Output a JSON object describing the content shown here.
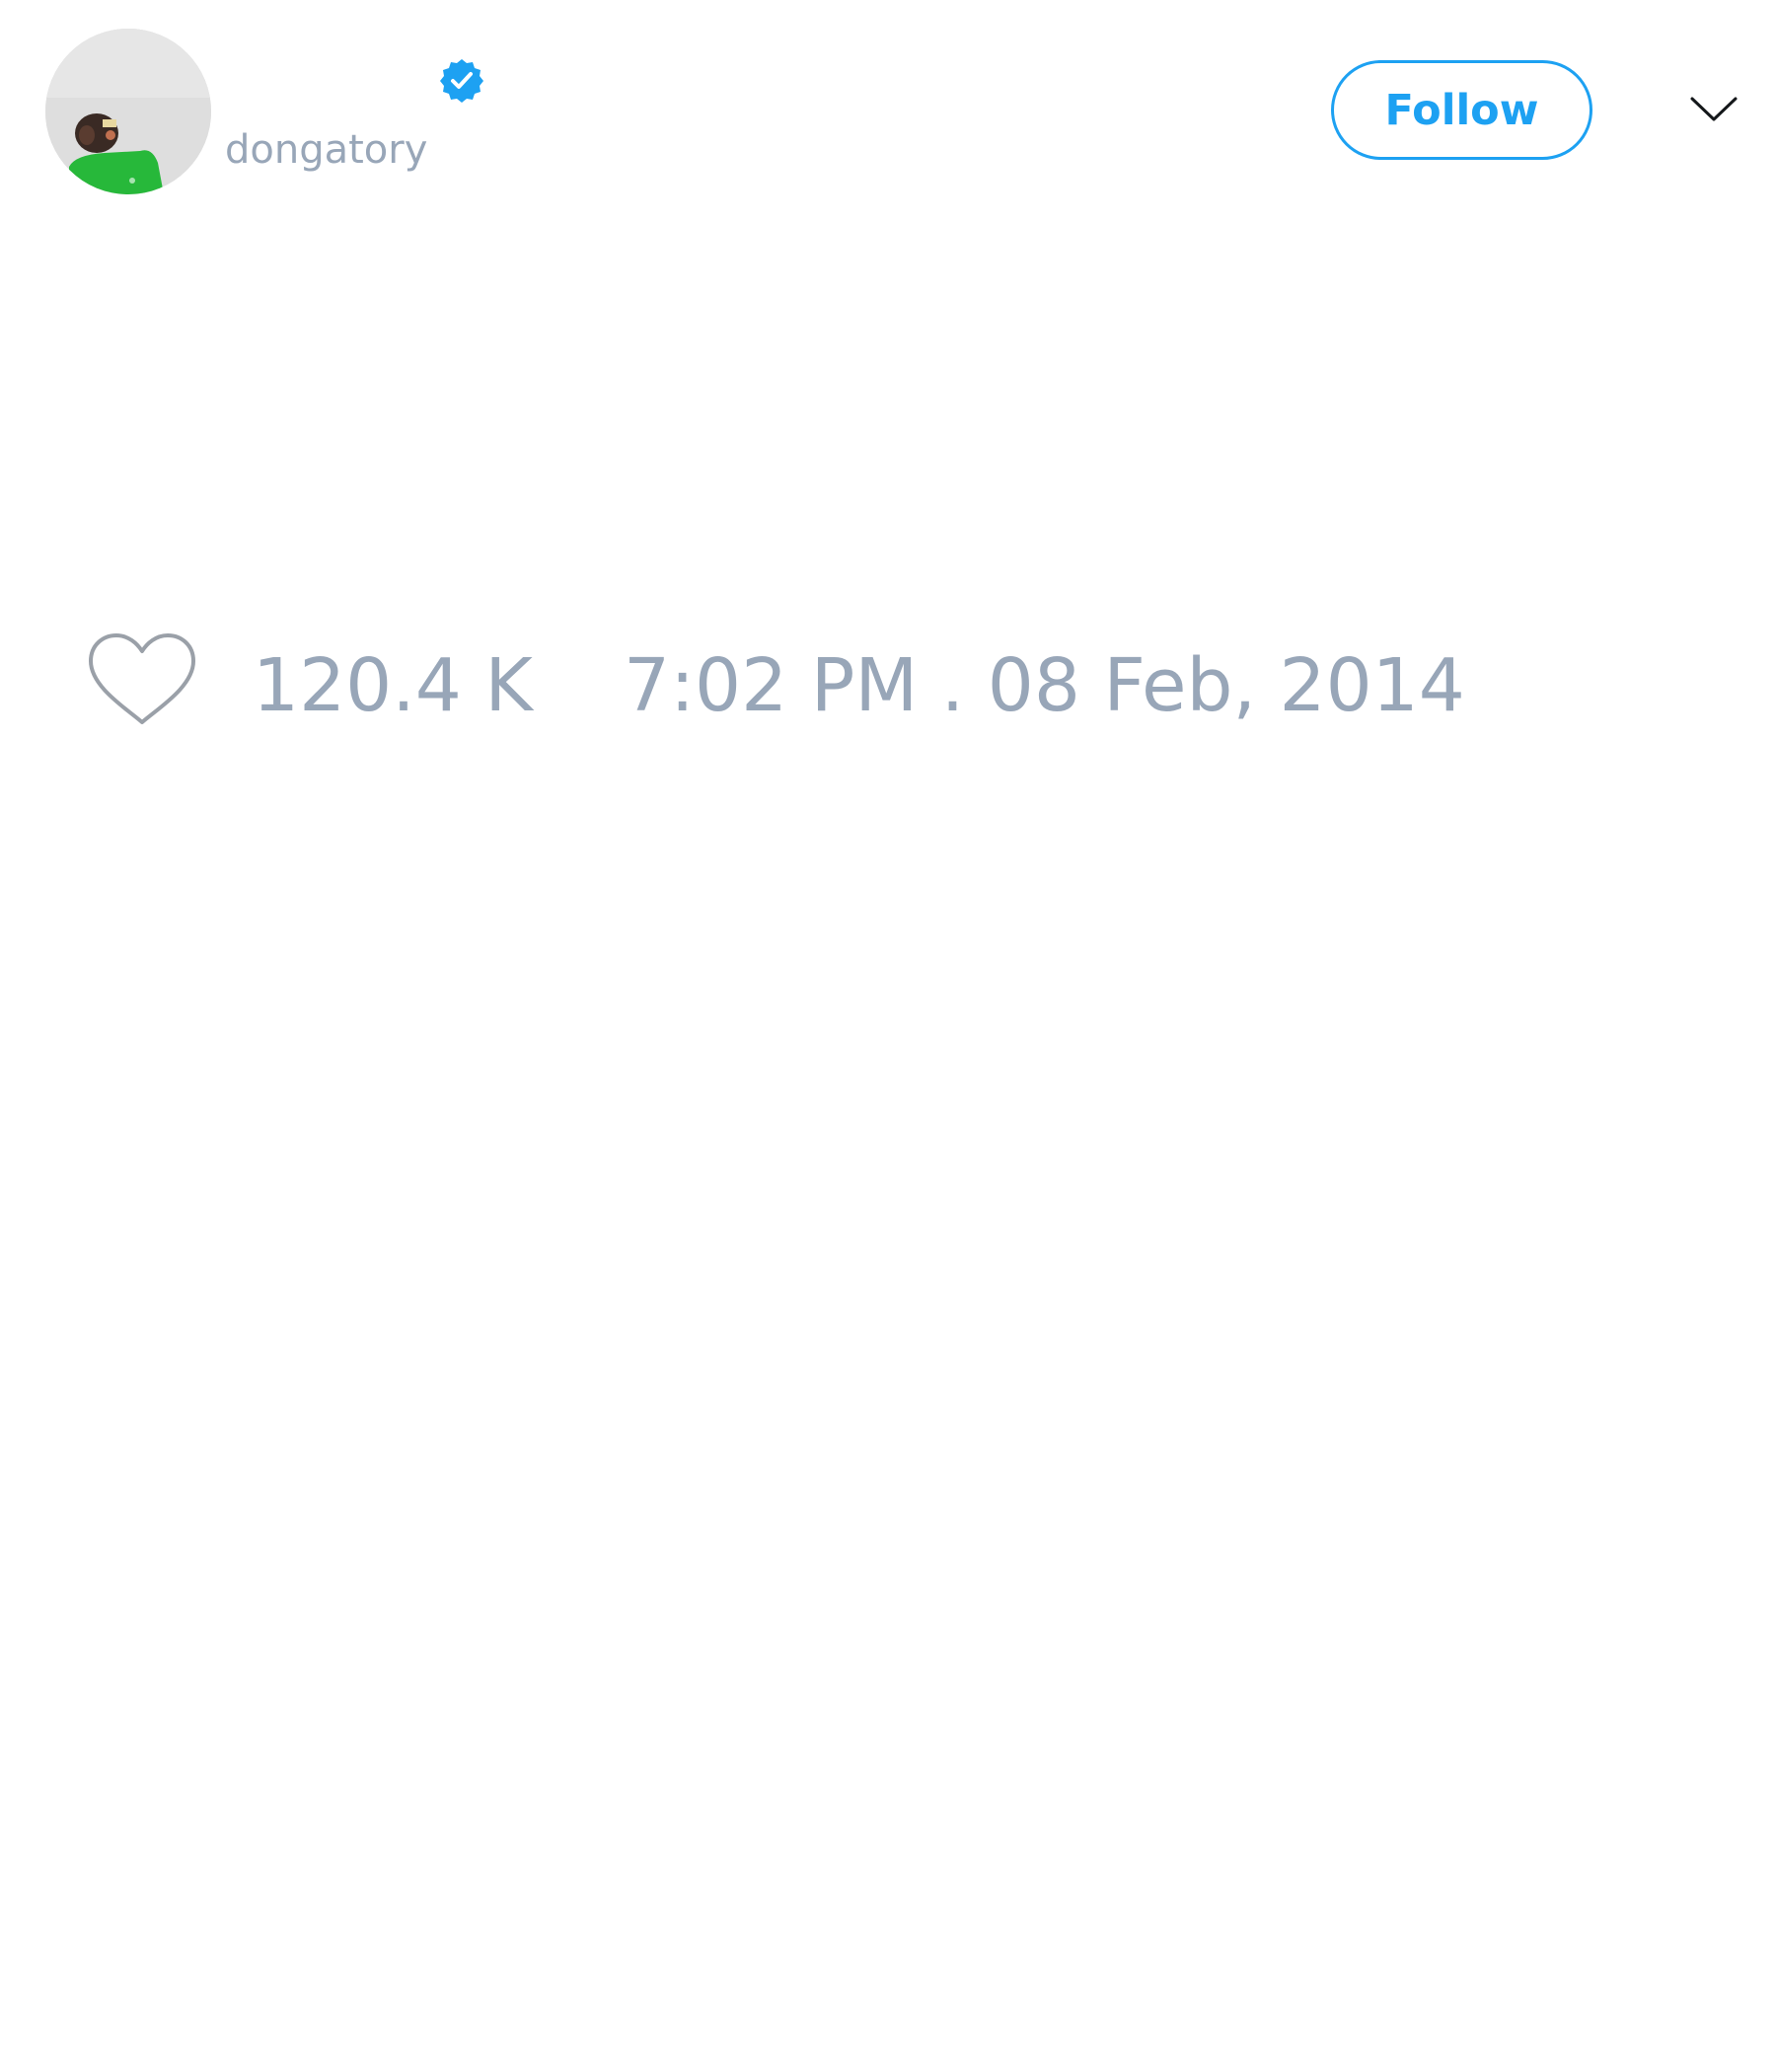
{
  "author": {
    "display_name": "",
    "username": "dongatory",
    "verified": true,
    "verified_icon": "verified-badge-icon",
    "avatar_icon": "avatar-image"
  },
  "actions": {
    "follow_label": "Follow",
    "menu_icon": "chevron-down-icon"
  },
  "stats": {
    "like_icon": "heart-outline-icon",
    "likes": "120.4 K",
    "timestamp": "7:02 PM . 08 Feb, 2014"
  },
  "colors": {
    "accent": "#1da1f2",
    "muted_text": "#98a6b8",
    "background": "#ffffff"
  }
}
